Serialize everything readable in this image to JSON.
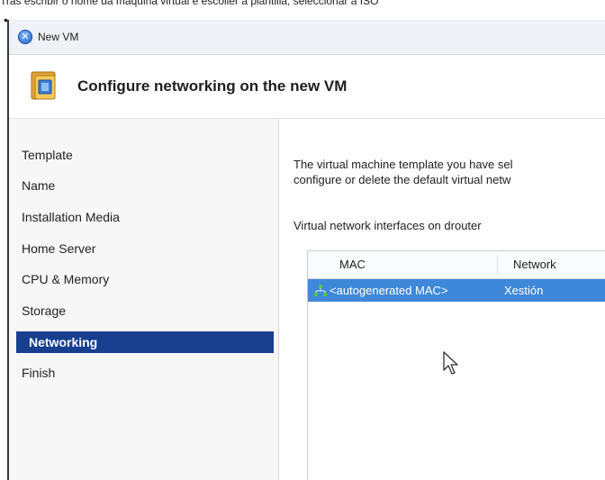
{
  "caption": "Tras escribir o nome da máquina virtual e escoller a plantilla, seleccionar a ISO",
  "window": {
    "title": "New VM"
  },
  "header": {
    "title": "Configure networking on the new VM"
  },
  "sidebar": {
    "items": [
      {
        "label": "Template",
        "active": false
      },
      {
        "label": "Name",
        "active": false
      },
      {
        "label": "Installation Media",
        "active": false
      },
      {
        "label": "Home Server",
        "active": false
      },
      {
        "label": "CPU & Memory",
        "active": false
      },
      {
        "label": "Storage",
        "active": false
      },
      {
        "label": "Networking",
        "active": true
      },
      {
        "label": "Finish",
        "active": false
      }
    ]
  },
  "content": {
    "description_line1": "The virtual machine template you have sel",
    "description_line2": "configure or delete the default virtual netw",
    "list_label": "Virtual network interfaces on drouter",
    "table": {
      "columns": [
        "MAC",
        "Network"
      ],
      "rows": [
        {
          "mac": "<autogenerated MAC>",
          "network": "Xestión",
          "selected": true
        }
      ]
    }
  },
  "colors": {
    "selection": "#173f8e",
    "row_highlight": "#3f88d9"
  }
}
